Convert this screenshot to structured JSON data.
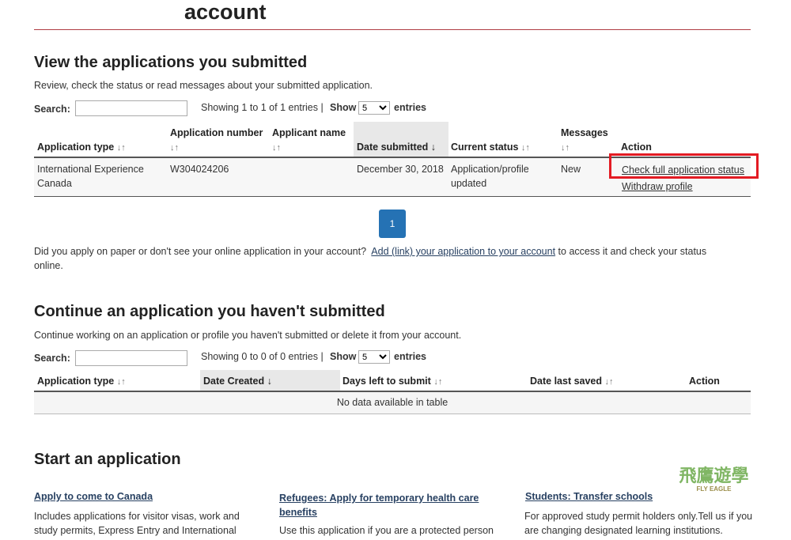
{
  "header": {
    "title": "account"
  },
  "submitted": {
    "heading": "View the applications you submitted",
    "intro": "Review, check the status or read messages about your submitted application.",
    "search_label": "Search:",
    "showing": "Showing 1 to 1 of 1 entries |",
    "show_label": "Show",
    "show_value": "5",
    "entries_label": "entries",
    "columns": [
      "Application type",
      "Application number",
      "Applicant name",
      "Date submitted",
      "Current status",
      "Messages",
      "Action"
    ],
    "row": {
      "type": "International Experience Canada",
      "number": "W304024206",
      "date": "December 30, 2018",
      "status": "Application/profile updated",
      "messages": "New",
      "action1": "Check full application status",
      "action2": "Withdraw profile"
    },
    "page": "1",
    "paper_text": "Did you apply on paper or don't see your online application in your account?",
    "link_text": "Add (link) your application to your account",
    "paper_text2": "to access it and check your status online."
  },
  "unsubmitted": {
    "heading": "Continue an application you haven't submitted",
    "intro": "Continue working on an application or profile you haven't submitted or delete it from your account.",
    "search_label": "Search:",
    "showing": "Showing 0 to 0 of 0 entries |",
    "show_label": "Show",
    "show_value": "5",
    "entries_label": "entries",
    "columns": [
      "Application type",
      "Date Created",
      "Days left to submit",
      "Date last saved",
      "Action"
    ],
    "empty": "No data available in table"
  },
  "start": {
    "heading": "Start an application",
    "items": [
      {
        "title": "Apply to come to Canada",
        "desc": "Includes applications for visitor visas, work and study permits, Express Entry and International"
      },
      {
        "title": "Refugees: Apply for temporary health care benefits",
        "desc": "Use this application if you are a protected person"
      },
      {
        "title": "Students: Transfer schools",
        "desc": "For approved study permit holders only.Tell us if you are changing designated learning institutions."
      }
    ]
  },
  "watermark": {
    "text": "飛鷹遊學",
    "sub": "FLY EAGLE"
  },
  "colors": {
    "accent": "#af3c43",
    "link": "#284162",
    "button": "#2572b4",
    "highlight": "#e31b23"
  }
}
